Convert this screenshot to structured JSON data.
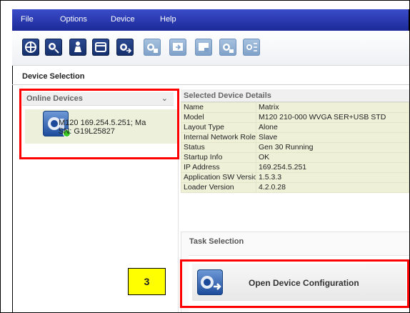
{
  "menu": {
    "file": "File",
    "options": "Options",
    "device": "Device",
    "help": "Help"
  },
  "toolbar": {
    "buttons": [
      {
        "icon": "compass-icon",
        "enabled": true
      },
      {
        "icon": "search-camera-icon",
        "enabled": true
      },
      {
        "icon": "person-icon",
        "enabled": true
      },
      {
        "icon": "window-icon",
        "enabled": true
      },
      {
        "icon": "camera-export-icon",
        "enabled": true
      },
      {
        "icon": "camera-disabled-icon",
        "enabled": false
      },
      {
        "icon": "monitor-import-icon",
        "enabled": false
      },
      {
        "icon": "monitor-disabled-icon",
        "enabled": false
      },
      {
        "icon": "camera-settings-icon",
        "enabled": false
      },
      {
        "icon": "camera-list-icon",
        "enabled": false
      }
    ]
  },
  "device_selection": {
    "title": "Device Selection",
    "online_devices": {
      "header": "Online Devices",
      "items": [
        {
          "line1": "M120 169.254.5.251; Ma",
          "line2": "SN: G19L25827",
          "status_color": "#37c71f"
        }
      ]
    }
  },
  "details": {
    "header": "Selected Device Details",
    "rows": [
      {
        "key": "Name",
        "value": "Matrix"
      },
      {
        "key": "Model",
        "value": "M120 210-000 WVGA SER+USB STD"
      },
      {
        "key": "Layout Type",
        "value": "Alone"
      },
      {
        "key": "Internal Network Role",
        "value": "Slave"
      },
      {
        "key": "Status",
        "value": "Gen 30  Running"
      },
      {
        "key": "Startup Info",
        "value": "OK"
      },
      {
        "key": "IP Address",
        "value": "169.254.5.251"
      },
      {
        "key": "Application SW Version",
        "value": "1.5.3.3"
      },
      {
        "key": "Loader Version",
        "value": "4.2.0.28"
      }
    ]
  },
  "task_selection": {
    "title": "Task Selection",
    "open_config_label": "Open Device Configuration"
  },
  "annotation": {
    "step_number": "3",
    "highlight_color": "#ff0000",
    "badge_color": "#ffff00"
  }
}
